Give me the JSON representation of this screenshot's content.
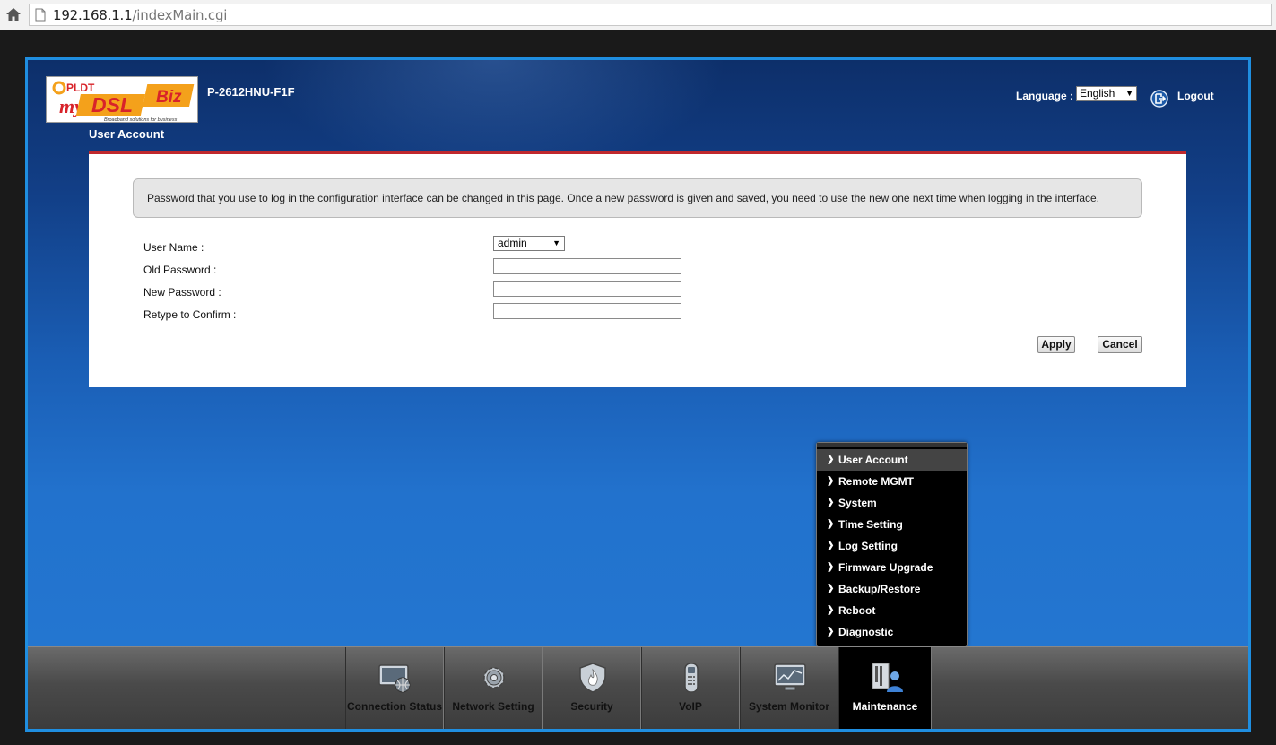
{
  "browser": {
    "url_host": "192.168.1.1",
    "url_path": "/indexMain.cgi"
  },
  "header": {
    "logo_text": {
      "pldt": "PLDT",
      "my": "my",
      "dsl": "DSL",
      "biz": "Biz",
      "tagline": "Broadband solutions for business"
    },
    "model": "P-2612HNU-F1F",
    "page_title": "User Account",
    "language_label": "Language :",
    "language_value": "English",
    "logout_label": "Logout"
  },
  "content": {
    "note": "Password that you use to log in the configuration interface can be changed in this page. Once a new password is given and saved, you need to use the new one next time when logging in the interface.",
    "fields": {
      "user_name_label": "User Name :",
      "user_name_value": "admin",
      "old_password_label": "Old Password :",
      "new_password_label": "New Password :",
      "retype_label": "Retype to Confirm :"
    },
    "apply_label": "Apply",
    "cancel_label": "Cancel"
  },
  "maintenance_menu": {
    "items": [
      {
        "label": "User Account",
        "active": true
      },
      {
        "label": "Remote MGMT"
      },
      {
        "label": "System"
      },
      {
        "label": "Time Setting"
      },
      {
        "label": "Log Setting"
      },
      {
        "label": "Firmware Upgrade"
      },
      {
        "label": "Backup/Restore"
      },
      {
        "label": "Reboot"
      },
      {
        "label": "Diagnostic"
      }
    ]
  },
  "navbar": {
    "items": [
      {
        "label": "Connection Status",
        "icon": "monitor-globe-icon"
      },
      {
        "label": "Network Setting",
        "icon": "gear-icon"
      },
      {
        "label": "Security",
        "icon": "shield-flame-icon"
      },
      {
        "label": "VoIP",
        "icon": "phone-icon"
      },
      {
        "label": "System Monitor",
        "icon": "chart-monitor-icon"
      },
      {
        "label": "Maintenance",
        "icon": "maintenance-user-icon",
        "active": true
      }
    ]
  },
  "colors": {
    "frame_border": "#1f8ee0",
    "panel_accent": "#c0282d",
    "logo_red": "#d8232a",
    "logo_orange": "#f4a11b"
  }
}
